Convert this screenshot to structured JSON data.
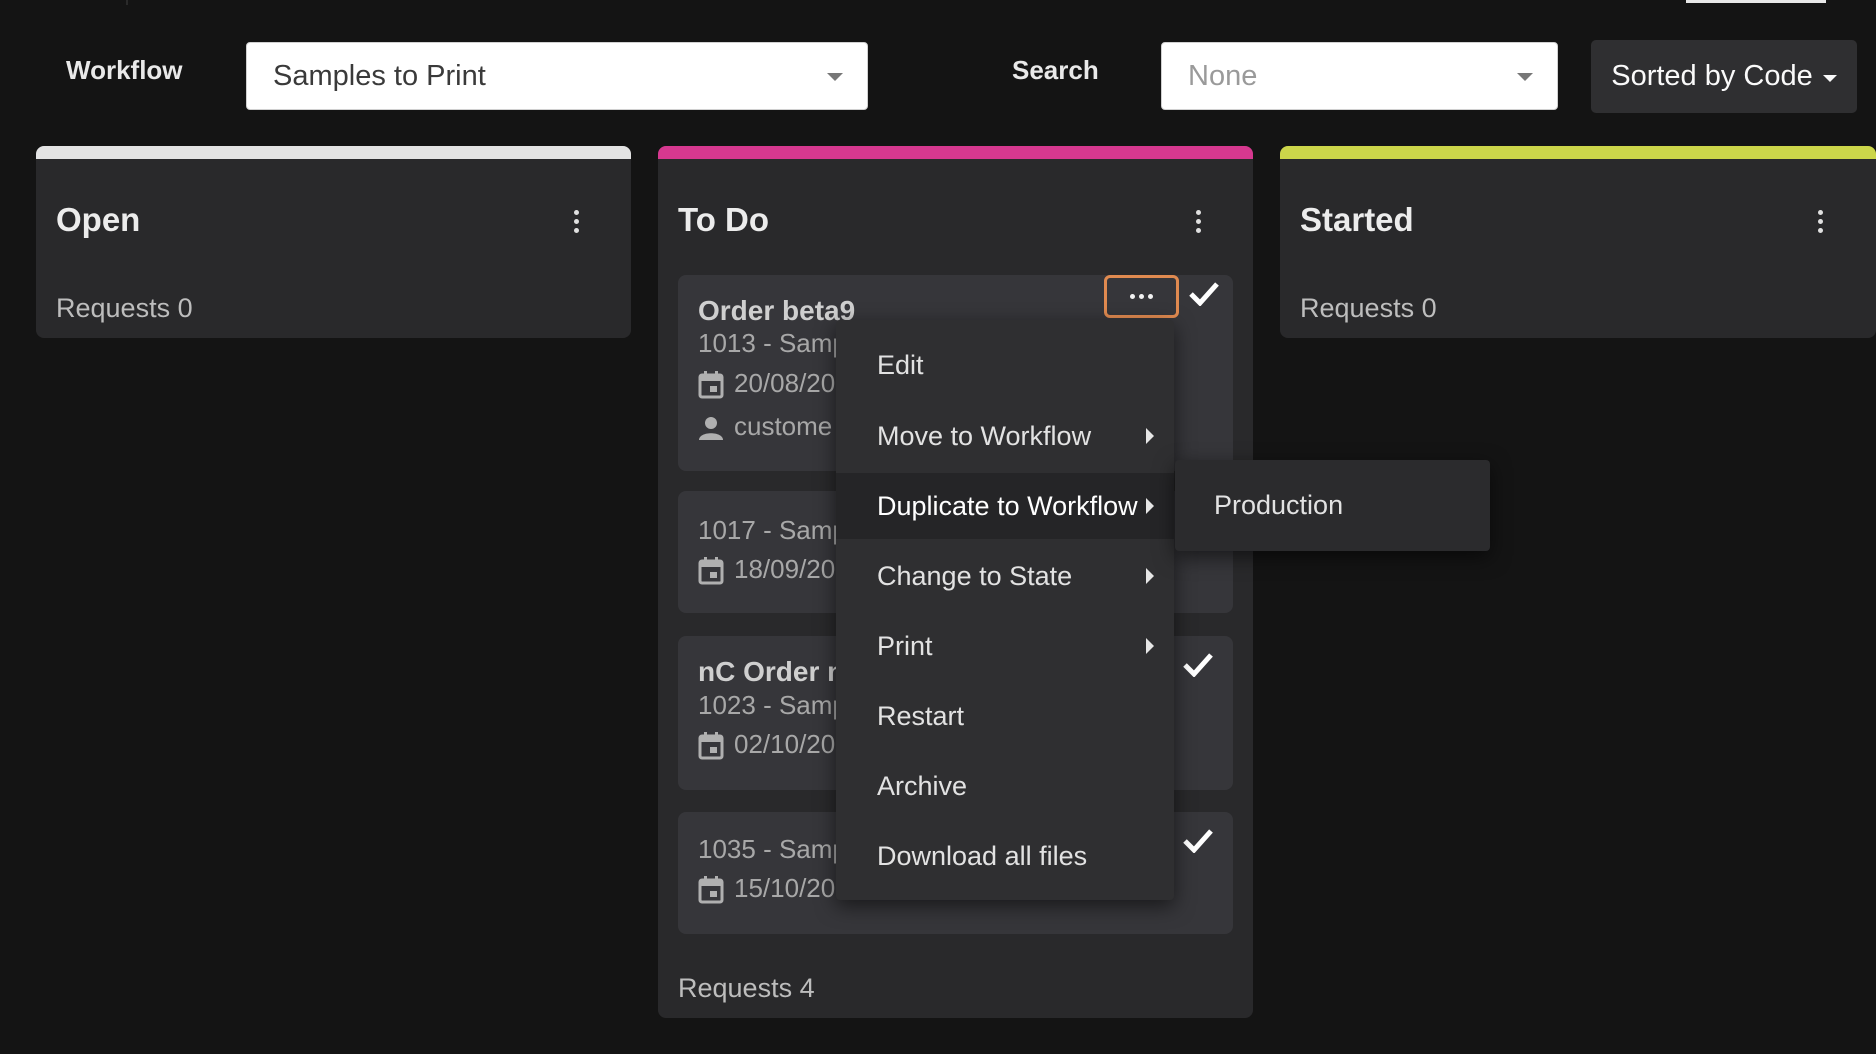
{
  "toolbar": {
    "workflow_label": "Workflow",
    "workflow_value": "Samples to Print",
    "search_label": "Search",
    "search_placeholder": "None",
    "sort_label": "Sorted by Code"
  },
  "colors": {
    "open_bar": "#e3e3e3",
    "todo_bar": "#d6388f",
    "started_bar": "#ccd64a",
    "focus_outline": "#e08a50"
  },
  "columns": [
    {
      "title": "Open",
      "requests": "Requests 0"
    },
    {
      "title": "To Do",
      "requests": "Requests 4"
    },
    {
      "title": "Started",
      "requests": "Requests 0"
    }
  ],
  "cards": [
    {
      "title": "Order beta9",
      "code": "1013 - Samp",
      "date": "20/08/20",
      "customer": "custome",
      "icon_date": "calendar-icon",
      "icon_user": "person-icon",
      "checked": true
    },
    {
      "code": "1017 - Samp",
      "date": "18/09/20",
      "icon_date": "calendar-icon",
      "checked": false
    },
    {
      "title": "nC Order n",
      "code": "1023 - Samp",
      "date": "02/10/20",
      "icon_date": "calendar-icon",
      "checked": true
    },
    {
      "code": "1035 - Samp",
      "date": "15/10/20",
      "icon_date": "calendar-icon",
      "checked": true
    }
  ],
  "context_menu": {
    "items": [
      {
        "label": "Edit"
      },
      {
        "label": "Move to Workflow",
        "submenu": true
      },
      {
        "label": "Duplicate to Workflow",
        "submenu": true,
        "active": true
      },
      {
        "label": "Change to State",
        "submenu": true
      },
      {
        "label": "Print",
        "submenu": true
      },
      {
        "label": "Restart"
      },
      {
        "label": "Archive"
      },
      {
        "label": "Download all files"
      }
    ],
    "submenu_items": [
      {
        "label": "Production"
      }
    ]
  }
}
